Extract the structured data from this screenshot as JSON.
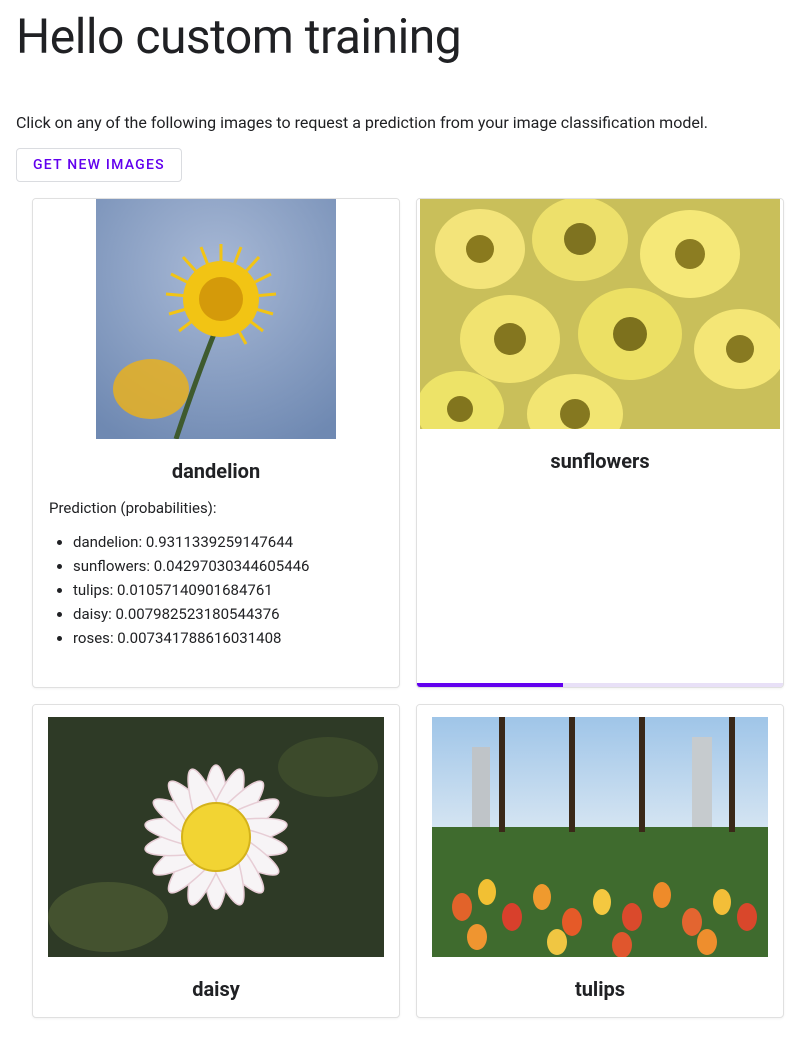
{
  "header": {
    "title": "Hello custom training",
    "subtitle": "Click on any of the following images to request a prediction from your image classification model.",
    "get_images_btn": "Get New Images"
  },
  "cards": [
    {
      "label": "dandelion",
      "image": "dandelion",
      "has_prediction": true,
      "prediction_title": "Prediction (probabilities):",
      "predictions": [
        {
          "class": "dandelion",
          "prob": "0.9311339259147644"
        },
        {
          "class": "sunflowers",
          "prob": "0.04297030344605446"
        },
        {
          "class": "tulips",
          "prob": "0.01057140901684761"
        },
        {
          "class": "daisy",
          "prob": "0.007982523180544376"
        },
        {
          "class": "roses",
          "prob": "0.007341788616031408"
        }
      ]
    },
    {
      "label": "sunflowers",
      "image": "sunflowers",
      "loading": true
    },
    {
      "label": "daisy",
      "image": "daisy"
    },
    {
      "label": "tulips",
      "image": "tulips"
    }
  ]
}
